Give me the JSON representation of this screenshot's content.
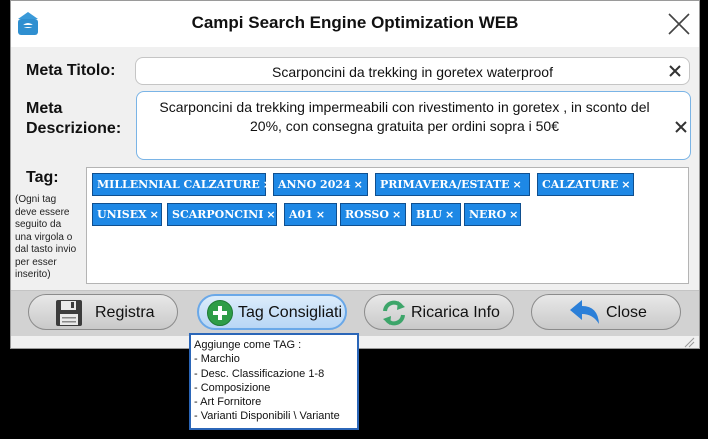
{
  "window": {
    "title": "Campi Search Engine Optimization WEB"
  },
  "meta_title": {
    "label": "Meta Titolo:",
    "value": "Scarponcini da trekking in goretex waterproof"
  },
  "meta_description": {
    "label_line1": "Meta",
    "label_line2": "Descrizione:",
    "value_line1": "Scarponcini da trekking impermeabili con rivestimento in goretex , in sconto del",
    "value_line2": "20%, con consegna gratuita per ordini sopra i 50€"
  },
  "tags": {
    "label": "Tag:",
    "hint": [
      "(Ogni tag",
      "deve essere",
      "seguito da",
      "una virgola o",
      "dal tasto invio",
      "per esser",
      "inserito)"
    ],
    "remove_glyph": "×",
    "items": [
      "MILLENNIAL CALZATURE",
      "ANNO 2024",
      "PRIMAVERA/ESTATE",
      "CALZATURE",
      "UNISEX",
      "SCARPONCINI",
      "A01",
      "ROSSO",
      "BLU",
      "NERO"
    ]
  },
  "buttons": {
    "registra": "Registra",
    "tag_consigliati": "Tag Consigliati",
    "ricarica_info": "Ricarica Info",
    "close": "Close"
  },
  "tooltip": {
    "lines": [
      "Aggiunge come TAG :",
      "- Marchio",
      "- Desc. Classificazione 1-8",
      "- Composizione",
      "- Art Fornitore",
      "- Varianti Disponibili \\ Variante"
    ]
  },
  "colors": {
    "tag_bg": "#1e88e5",
    "tooltip_border": "#2b66b8",
    "add_icon": "#2e9d47",
    "close_arrow": "#2b7fd8"
  }
}
